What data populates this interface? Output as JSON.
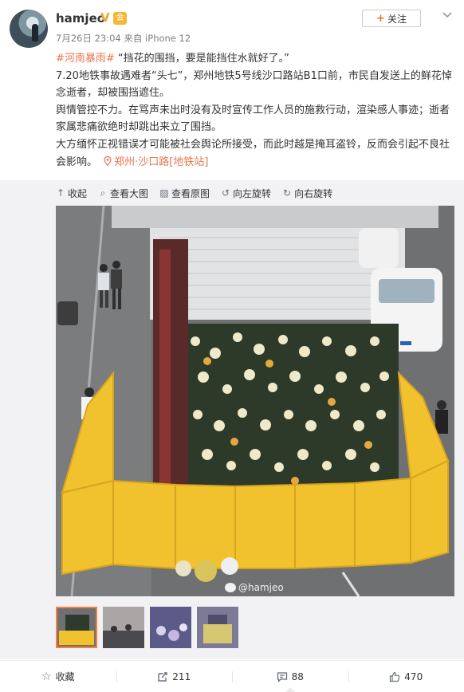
{
  "user": {
    "name": "hamjeo",
    "verified_badge": "V",
    "member_badge": "会"
  },
  "meta": {
    "date": "7月26日 23:04",
    "source": "来自 iPhone 12"
  },
  "follow_label": "关注",
  "post": {
    "hashtag": "#河南暴雨#",
    "line1": " “挡花的围挡，要是能挡住水就好了。”",
    "line2": "7.20地铁事故遇难者“头七”，郑州地铁5号线沙口路站B1口前，市民自发送上的鲜花悼念逝者，却被围挡遮住。",
    "line3": "舆情管控不力。在骂声未出时没有及时宣传工作人员的施救行动，渲染感人事迹；逝者家属悲痛欲绝时却跳出来立了围挡。",
    "line4": "大方缅怀正视错误才可能被社会舆论所接受，而此时越是掩耳盗铃，反而会引起不良社会影响。",
    "location": "郑州·沙口路[地铁站]"
  },
  "toolbar": {
    "collapse": "收起",
    "view_large": "查看大图",
    "view_original": "查看原图",
    "rotate_left": "向左旋转",
    "rotate_right": "向右旋转"
  },
  "photo": {
    "watermark": "@hamjeo"
  },
  "thumbnails": [
    {
      "icon": "thumbnail-barrier-flowers",
      "active": true
    },
    {
      "icon": "thumbnail-crowd"
    },
    {
      "icon": "thumbnail-flowers-night"
    },
    {
      "icon": "thumbnail-memorial"
    }
  ],
  "footer": {
    "favorite": "收藏",
    "repost_count": "211",
    "comment_count": "88",
    "like_count": "470"
  },
  "colors": {
    "accent": "#eb7350",
    "barrier_yellow": "#f2c12e"
  }
}
